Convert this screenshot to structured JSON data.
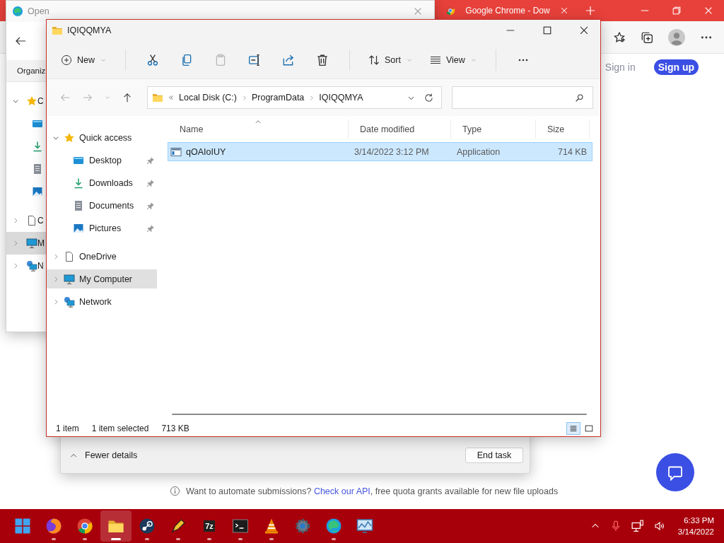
{
  "browser": {
    "tabs": [
      {
        "title": "Google Chrome - Dow",
        "selected": false
      }
    ],
    "sign_in": "Sign in",
    "sign_up": "Sign up",
    "notice": {
      "before": "Want to automate submissions? ",
      "link": "Check our API",
      "after": ", free quota grants available for new file uploads"
    }
  },
  "open_dialog": {
    "title": "Open",
    "toolbar_label": "Organiz",
    "tree": [
      {
        "kind": "quick_access",
        "label": "C",
        "expanded": true,
        "selected": false,
        "children": [
          {
            "kind": "desktop",
            "selected": false
          },
          {
            "kind": "downloads",
            "selected": false
          },
          {
            "kind": "documents",
            "selected": false
          },
          {
            "kind": "pictures",
            "selected": false
          }
        ]
      },
      {
        "kind": "onedrive",
        "label": "C",
        "expanded": false,
        "selected": false
      },
      {
        "kind": "computer",
        "label": "M",
        "expanded": false,
        "selected": true
      },
      {
        "kind": "network",
        "label": "N",
        "expanded": false,
        "selected": false
      }
    ]
  },
  "task_manager": {
    "toggle_label": "Fewer details",
    "end_task": "End task"
  },
  "explorer": {
    "title": "IQIQQMYA",
    "toolbar": [
      {
        "kind": "new",
        "label": "New",
        "dropdown": true
      },
      {
        "kind": "separator"
      },
      {
        "kind": "cut",
        "disabled": false
      },
      {
        "kind": "copy",
        "disabled": false
      },
      {
        "kind": "paste",
        "disabled": true
      },
      {
        "kind": "rename",
        "disabled": false
      },
      {
        "kind": "share",
        "disabled": false
      },
      {
        "kind": "delete",
        "disabled": false
      },
      {
        "kind": "separator"
      },
      {
        "kind": "sort",
        "label": "Sort",
        "dropdown": true
      },
      {
        "kind": "view",
        "label": "View",
        "dropdown": true
      },
      {
        "kind": "separator"
      },
      {
        "kind": "more"
      }
    ],
    "nav": {
      "back_disabled": true,
      "forward_disabled": true
    },
    "path": [
      "Local Disk (C:)",
      "ProgramData",
      "IQIQQMYA"
    ],
    "sidebar": [
      {
        "kind": "quick_access",
        "label": "Quick access",
        "expanded": true,
        "selected": false,
        "children": [
          {
            "kind": "desktop",
            "label": "Desktop",
            "pinned": true,
            "selected": false
          },
          {
            "kind": "downloads",
            "label": "Downloads",
            "pinned": true,
            "selected": false
          },
          {
            "kind": "documents",
            "label": "Documents",
            "pinned": true,
            "selected": false
          },
          {
            "kind": "pictures",
            "label": "Pictures",
            "pinned": true,
            "selected": false
          }
        ]
      },
      {
        "kind": "onedrive",
        "label": "OneDrive",
        "expanded": false,
        "selected": false
      },
      {
        "kind": "computer",
        "label": "My Computer",
        "expanded": false,
        "selected": true
      },
      {
        "kind": "network",
        "label": "Network",
        "expanded": false,
        "selected": false
      }
    ],
    "columns": [
      {
        "label": "Name",
        "sorted": true
      },
      {
        "label": "Date modified",
        "sorted": false
      },
      {
        "label": "Type",
        "sorted": false
      },
      {
        "label": "Size",
        "sorted": false
      }
    ],
    "rows": [
      {
        "cells": [
          "qOAIoIUY",
          "3/14/2022 3:12 PM",
          "Application",
          "714 KB"
        ],
        "selected": true
      }
    ],
    "status": {
      "count": "1 item",
      "selection": "1 item selected",
      "size": "713 KB"
    },
    "views": [
      {
        "kind": "details",
        "selected": true
      },
      {
        "kind": "tiles",
        "selected": false
      }
    ]
  },
  "taskbar": {
    "apps": [
      {
        "kind": "start",
        "running": false,
        "active": false
      },
      {
        "kind": "firefox",
        "running": true,
        "active": false
      },
      {
        "kind": "chrome",
        "running": true,
        "active": false
      },
      {
        "kind": "files",
        "running": true,
        "active": true
      },
      {
        "kind": "steam",
        "running": true,
        "active": false
      },
      {
        "kind": "pen",
        "running": true,
        "active": false
      },
      {
        "kind": "archiver",
        "label": "7z",
        "running": true,
        "active": false
      },
      {
        "kind": "terminal",
        "running": true,
        "active": false
      },
      {
        "kind": "player",
        "running": true,
        "active": false
      },
      {
        "kind": "settings",
        "running": false,
        "active": false
      },
      {
        "kind": "edge",
        "running": true,
        "active": false
      },
      {
        "kind": "monitor",
        "running": false,
        "active": false
      }
    ],
    "time": "6:33 PM",
    "date": "3/14/2022"
  }
}
